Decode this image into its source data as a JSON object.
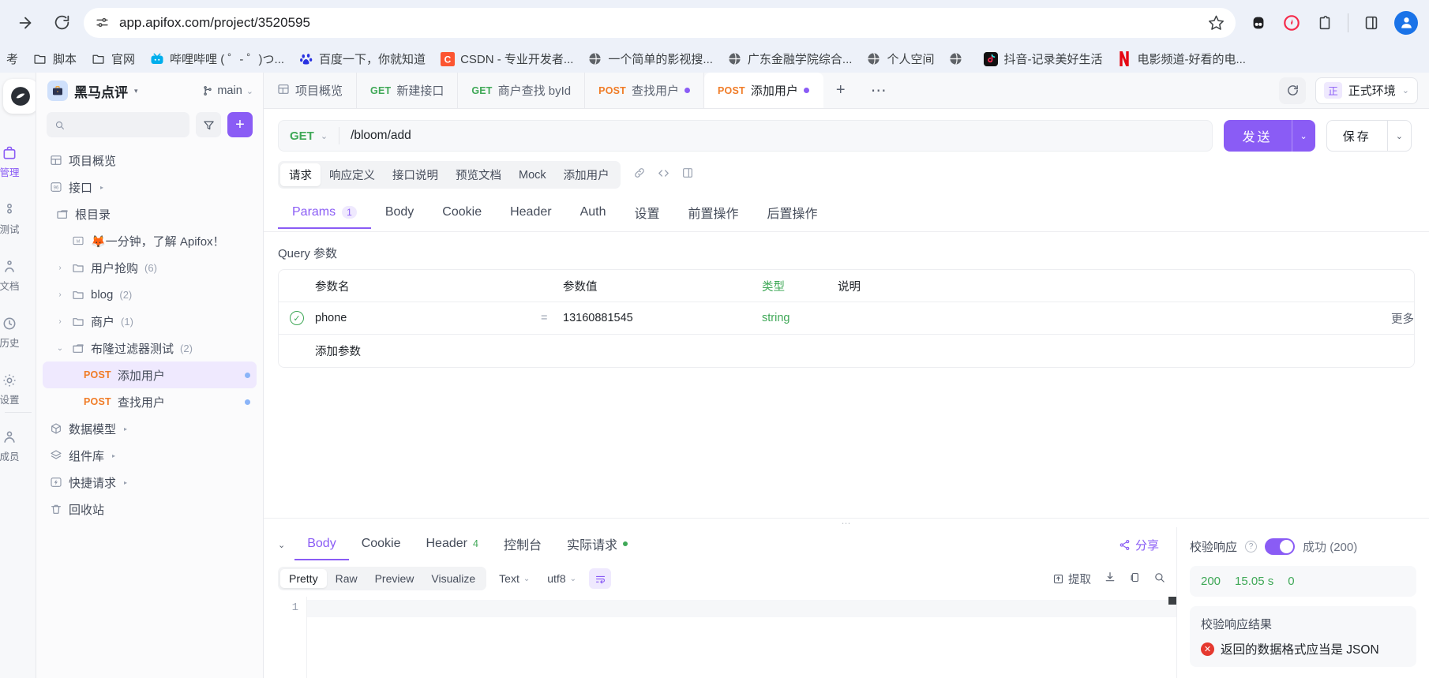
{
  "browser": {
    "url": "app.apifox.com/project/3520595",
    "icons": {
      "forward": "forward-arrow-icon",
      "reload": "reload-icon",
      "site_info": "site-settings-icon",
      "star": "bookmark-star-icon",
      "profile": "profile-avatar-icon"
    },
    "bookmarks": [
      {
        "label": "考",
        "icon": "bookmark-icon"
      },
      {
        "label": "脚本",
        "icon": "folder-icon"
      },
      {
        "label": "官网",
        "icon": "folder-icon"
      },
      {
        "label": "哔哩哔哩 ( ゜- ゜)つ...",
        "icon": "bilibili-icon"
      },
      {
        "label": "百度一下，你就知道",
        "icon": "baidu-icon"
      },
      {
        "label": "CSDN - 专业开发者...",
        "icon": "csdn-icon"
      },
      {
        "label": "一个简单的影视搜...",
        "icon": "globe-icon"
      },
      {
        "label": "广东金融学院综合...",
        "icon": "globe-icon"
      },
      {
        "label": "个人空间",
        "icon": "globe-icon"
      },
      {
        "label": "",
        "icon": "globe-icon"
      },
      {
        "label": "抖音-记录美好生活",
        "icon": "douyin-icon"
      },
      {
        "label": "电影频道-好看的电...",
        "icon": "netflix-icon"
      }
    ]
  },
  "rail": {
    "items": [
      {
        "label": "管理",
        "icon": "project-manage-icon",
        "active": true
      },
      {
        "label": "测试",
        "icon": "test-icon",
        "active": false
      },
      {
        "label": "文档",
        "icon": "doc-icon",
        "active": false
      },
      {
        "label": "历史",
        "icon": "history-icon",
        "active": false
      },
      {
        "label": "设置",
        "icon": "settings-icon",
        "active": false
      },
      {
        "label": "成员",
        "icon": "members-icon",
        "active": false
      }
    ]
  },
  "sidebar": {
    "project_name": "黑马点评",
    "branch": "main",
    "search_placeholder": "",
    "search_value": "",
    "tree": [
      {
        "label": "项目概览",
        "icon": "overview-icon",
        "indent": 0,
        "arrow": "",
        "count": "",
        "caret": false,
        "verb": "",
        "dot": "",
        "selected": false
      },
      {
        "label": "接口",
        "icon": "api-icon",
        "indent": 0,
        "arrow": "",
        "count": "",
        "caret": true,
        "verb": "",
        "dot": "",
        "selected": false
      },
      {
        "label": "根目录",
        "icon": "folder-open-icon",
        "indent": 1,
        "arrow": "",
        "count": "",
        "caret": false,
        "verb": "",
        "dot": "",
        "selected": false
      },
      {
        "label": "🦊一分钟，了解 Apifox！",
        "icon": "markdown-icon",
        "indent": 2,
        "arrow": "",
        "count": "",
        "caret": false,
        "verb": "",
        "dot": "",
        "selected": false
      },
      {
        "label": "用户抢购",
        "icon": "folder-icon",
        "indent": 1,
        "arrow": "›",
        "count": "(6)",
        "caret": false,
        "verb": "",
        "dot": "",
        "selected": false
      },
      {
        "label": "blog",
        "icon": "folder-icon",
        "indent": 1,
        "arrow": "›",
        "count": "(2)",
        "caret": false,
        "verb": "",
        "dot": "",
        "selected": false
      },
      {
        "label": "商户",
        "icon": "folder-icon",
        "indent": 1,
        "arrow": "›",
        "count": "(1)",
        "caret": false,
        "verb": "",
        "dot": "",
        "selected": false
      },
      {
        "label": "布隆过滤器测试",
        "icon": "folder-open-icon",
        "indent": 1,
        "arrow": "⌄",
        "count": "(2)",
        "caret": false,
        "verb": "",
        "dot": "",
        "selected": false
      },
      {
        "label": "添加用户",
        "icon": "",
        "indent": 3,
        "arrow": "",
        "count": "",
        "caret": false,
        "verb": "POST",
        "dot": "blue",
        "selected": true
      },
      {
        "label": "查找用户",
        "icon": "",
        "indent": 3,
        "arrow": "",
        "count": "",
        "caret": false,
        "verb": "POST",
        "dot": "blue",
        "selected": false
      },
      {
        "label": "数据模型",
        "icon": "model-icon",
        "indent": 0,
        "arrow": "",
        "count": "",
        "caret": true,
        "verb": "",
        "dot": "",
        "selected": false
      },
      {
        "label": "组件库",
        "icon": "components-icon",
        "indent": 0,
        "arrow": "",
        "count": "",
        "caret": true,
        "verb": "",
        "dot": "",
        "selected": false
      },
      {
        "label": "快捷请求",
        "icon": "quick-request-icon",
        "indent": 0,
        "arrow": "",
        "count": "",
        "caret": true,
        "verb": "",
        "dot": "",
        "selected": false
      },
      {
        "label": "回收站",
        "icon": "trash-icon",
        "indent": 0,
        "arrow": "",
        "count": "",
        "caret": false,
        "verb": "",
        "dot": "",
        "selected": false
      }
    ]
  },
  "tabs": [
    {
      "verb": "",
      "label": "项目概览",
      "icon": "overview-icon",
      "dot": false,
      "active": false
    },
    {
      "verb": "GET",
      "label": "新建接口",
      "icon": "",
      "dot": false,
      "active": false
    },
    {
      "verb": "GET",
      "label": "商户查找 byId",
      "icon": "",
      "dot": false,
      "active": false
    },
    {
      "verb": "POST",
      "label": "查找用户",
      "icon": "",
      "dot": true,
      "active": false
    },
    {
      "verb": "POST",
      "label": "添加用户",
      "icon": "",
      "dot": true,
      "active": true
    }
  ],
  "tabbar_right": {
    "refresh_icon": "refresh-icon",
    "env_badge": "正",
    "env_label": "正式环境"
  },
  "request": {
    "method": "GET",
    "url": "/bloom/add",
    "send_label": "发送",
    "save_label": "保存",
    "subtabs": [
      {
        "label": "请求",
        "active": true
      },
      {
        "label": "响应定义",
        "active": false
      },
      {
        "label": "接口说明",
        "active": false
      },
      {
        "label": "预览文档",
        "active": false
      },
      {
        "label": "Mock",
        "active": false
      },
      {
        "label": "添加用户",
        "active": false
      }
    ],
    "subtab_icons": [
      "link-icon",
      "code-icon",
      "panel-icon"
    ],
    "reqtabs": [
      {
        "label": "Params",
        "badge": "1",
        "active": true
      },
      {
        "label": "Body",
        "badge": "",
        "active": false
      },
      {
        "label": "Cookie",
        "badge": "",
        "active": false
      },
      {
        "label": "Header",
        "badge": "",
        "active": false
      },
      {
        "label": "Auth",
        "badge": "",
        "active": false
      },
      {
        "label": "设置",
        "badge": "",
        "active": false
      },
      {
        "label": "前置操作",
        "badge": "",
        "active": false
      },
      {
        "label": "后置操作",
        "badge": "",
        "active": false
      }
    ],
    "query_title": "Query 参数",
    "table_headers": [
      "参数名",
      "参数值",
      "类型",
      "说明"
    ],
    "rows": [
      {
        "enabled": true,
        "name": "phone",
        "eq": "=",
        "value": "13160881545",
        "type": "string",
        "desc": "",
        "more": "更多"
      }
    ],
    "add_row_label": "添加参数"
  },
  "response": {
    "tabs": [
      {
        "label": "Body",
        "badge": "",
        "dot": false,
        "active": true
      },
      {
        "label": "Cookie",
        "badge": "",
        "dot": false,
        "active": false
      },
      {
        "label": "Header",
        "badge": "4",
        "dot": false,
        "active": false
      },
      {
        "label": "控制台",
        "badge": "",
        "dot": false,
        "active": false
      },
      {
        "label": "实际请求",
        "badge": "",
        "dot": true,
        "active": false
      }
    ],
    "share_label": "分享",
    "formats": [
      {
        "label": "Pretty",
        "active": true
      },
      {
        "label": "Raw",
        "active": false
      },
      {
        "label": "Preview",
        "active": false
      },
      {
        "label": "Visualize",
        "active": false
      }
    ],
    "type_select": "Text",
    "encoding_select": "utf8",
    "wrap_icon": "word-wrap-icon",
    "actions": {
      "extract_label": "提取",
      "extract_icon": "extract-icon",
      "download_icon": "download-icon",
      "copy_icon": "copy-icon",
      "search_icon": "search-icon"
    },
    "body_lines": [
      "1"
    ],
    "validation": {
      "title": "校验响应",
      "toggle_on": true,
      "status_label": "成功",
      "status_code_text": "(200)",
      "metrics": {
        "status": "200",
        "time": "15.05 s",
        "size": "0"
      },
      "result_title": "校验响应结果",
      "errors": [
        "返回的数据格式应当是 JSON"
      ]
    }
  },
  "colors": {
    "accent": "#8a5cf5",
    "get": "#3fa857",
    "post": "#f07c27",
    "error": "#e5392f"
  }
}
